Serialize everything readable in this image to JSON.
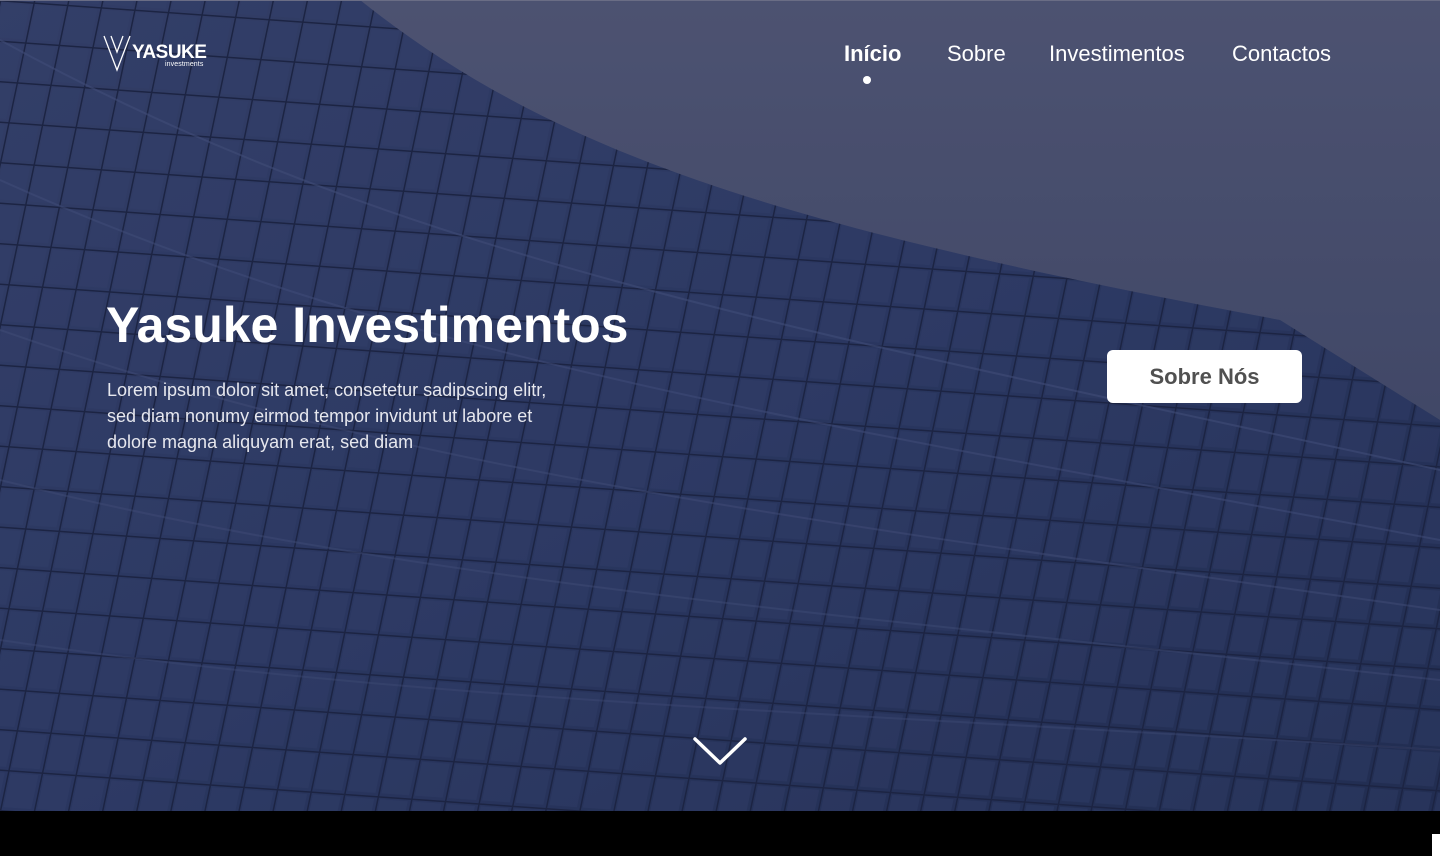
{
  "header": {
    "logo": {
      "brand": "YASUKE",
      "sub": "investments",
      "icon": "yasuke-logo-icon"
    },
    "nav": [
      {
        "label": "Início",
        "active": true
      },
      {
        "label": "Sobre",
        "active": false
      },
      {
        "label": "Investimentos",
        "active": false
      },
      {
        "label": "Contactos",
        "active": false
      }
    ]
  },
  "hero": {
    "title": "Yasuke Investimentos",
    "text": "Lorem ipsum dolor sit amet, consetetur sadipscing elitr, sed diam  nonumy eirmod tempor invidunt ut labore et dolore magna  aliquyam erat, sed diam",
    "cta_label": "Sobre Nós",
    "scroll_icon": "chevron-down-icon"
  },
  "colors": {
    "overlay": "#2b3558",
    "button_bg": "#ffffff",
    "button_text": "#505050"
  }
}
